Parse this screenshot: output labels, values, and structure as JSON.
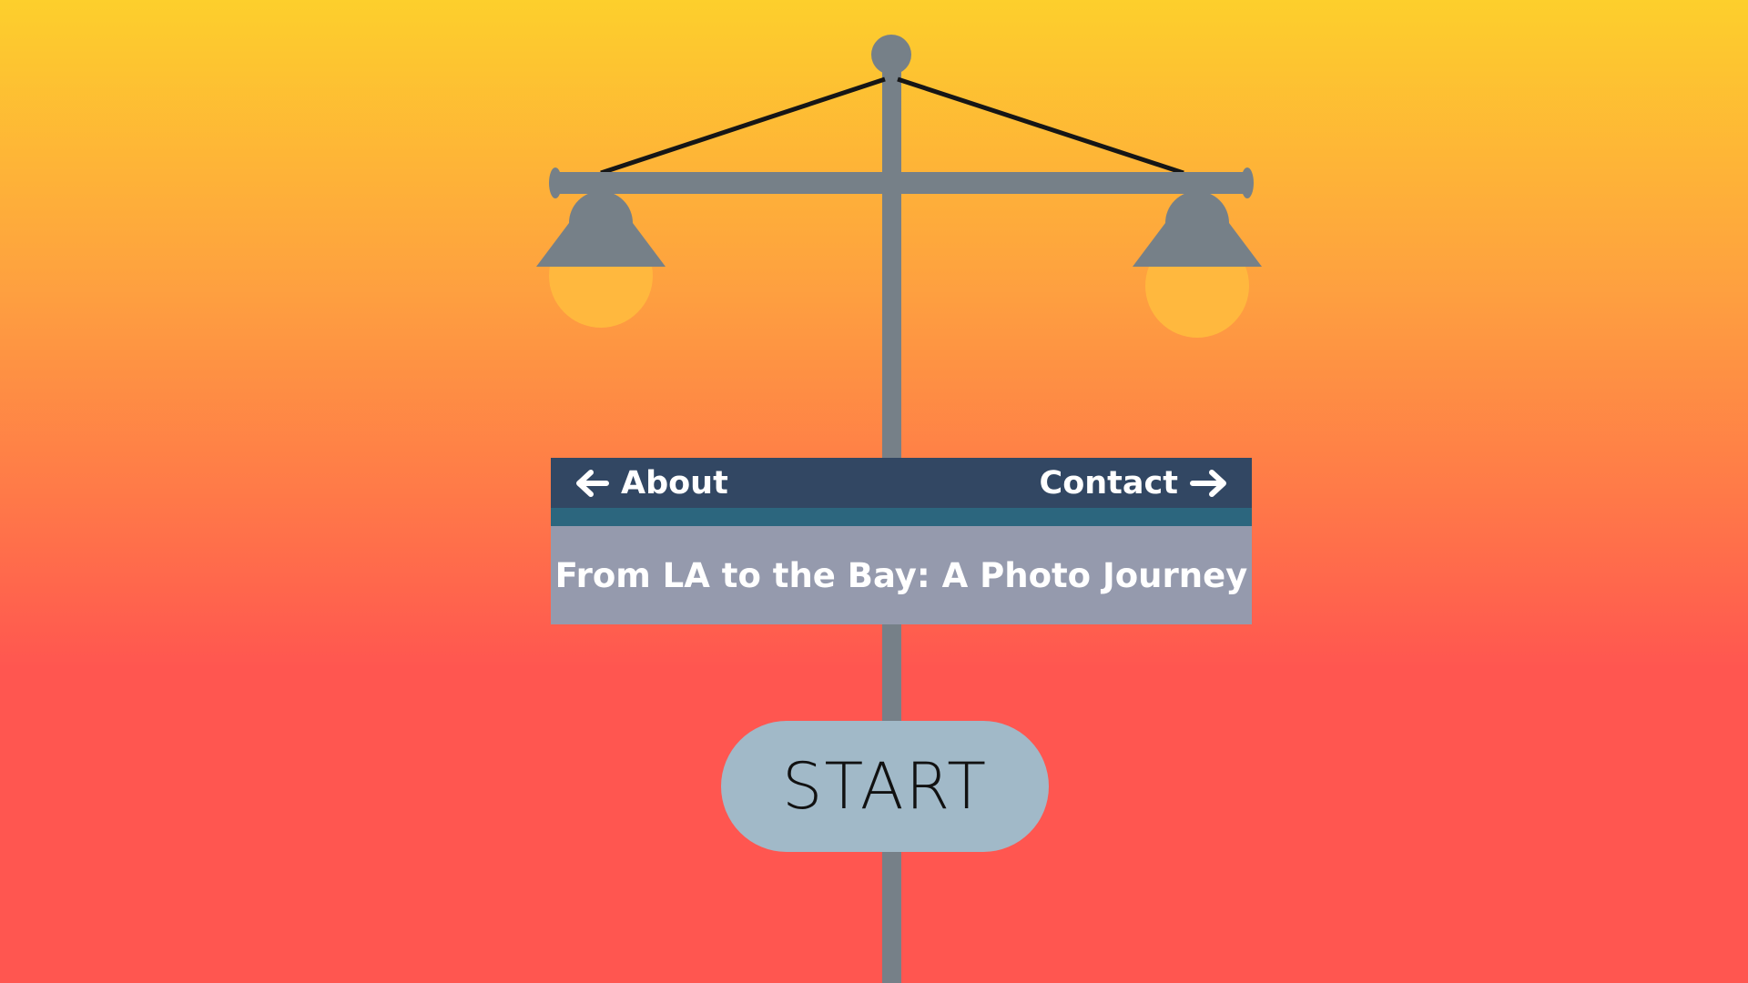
{
  "nav": {
    "about_label": "About",
    "contact_label": "Contact",
    "about_icon": "arrow-left-icon",
    "contact_icon": "arrow-right-icon"
  },
  "sign": {
    "title": "From LA to the Bay: A Photo Journey"
  },
  "start": {
    "label": "START"
  },
  "colors": {
    "sky_top": "#fdcf2c",
    "sky_bottom": "#ff5650",
    "pole": "#768088",
    "bulb": "#ffb83e",
    "sign_header": "#324763",
    "sign_stripe": "#2c667e",
    "sign_body": "#959aad",
    "start_button": "#a1b9c8"
  }
}
